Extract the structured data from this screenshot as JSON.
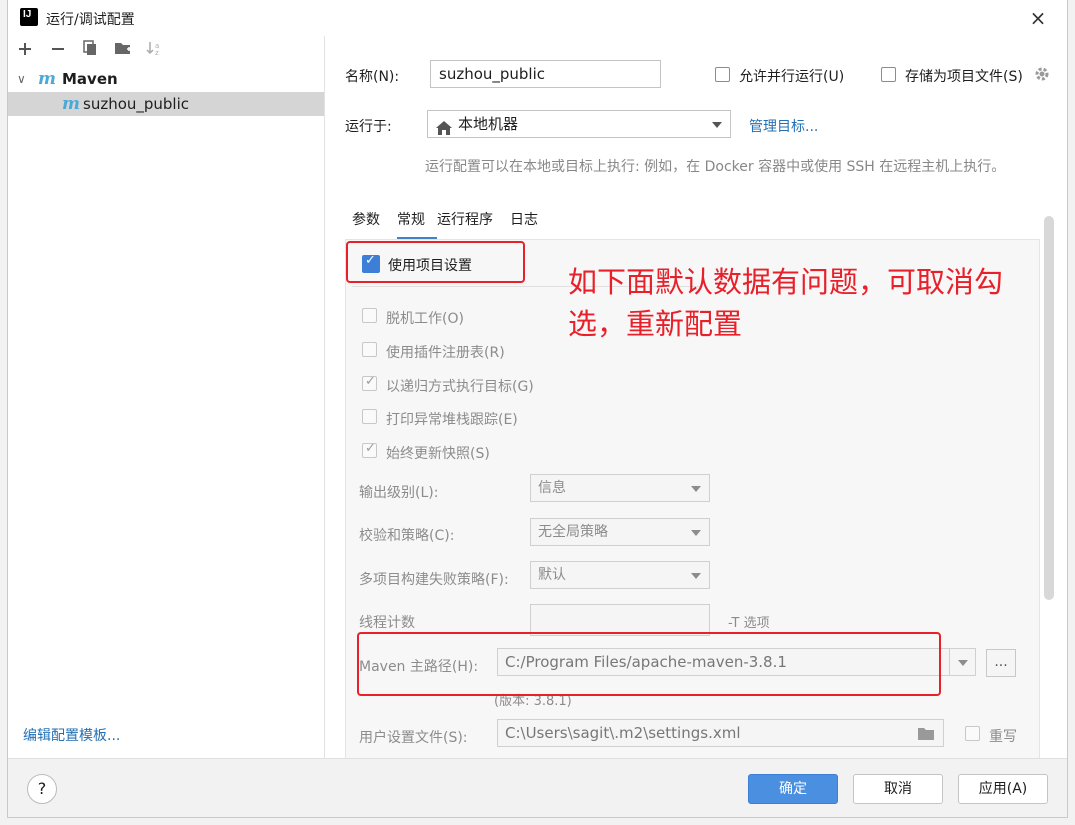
{
  "window": {
    "title": "运行/调试配置",
    "close_icon": "×"
  },
  "left_panel": {
    "toolbar_icons": [
      "plus-icon",
      "minus-icon",
      "copy-icon",
      "new-folder-icon",
      "sort-icon"
    ],
    "tree": {
      "group_label": "Maven",
      "item_label": "suzhou_public"
    },
    "edit_templates_link": "编辑配置模板..."
  },
  "form": {
    "name_label": "名称(N):",
    "name_value": "suzhou_public",
    "allow_parallel_label": "允许并行运行(U)",
    "store_as_file_label": "存储为项目文件(S)",
    "run_on_label": "运行于:",
    "run_on_value": "本地机器",
    "manage_targets_link": "管理目标...",
    "run_on_hint": "运行配置可以在本地或目标上执行: 例如，在 Docker 容器中或使用 SSH 在远程主机上执行。"
  },
  "tabs": [
    {
      "label": "参数"
    },
    {
      "label": "常规",
      "selected": true
    },
    {
      "label": "运行程序"
    },
    {
      "label": "日志"
    }
  ],
  "general": {
    "use_project_settings": {
      "label": "使用项目设置",
      "checked": true
    },
    "checkboxes": [
      {
        "label": "脱机工作(O)",
        "checked": false
      },
      {
        "label": "使用插件注册表(R)",
        "checked": false
      },
      {
        "label": "以递归方式执行目标(G)",
        "checked": true
      },
      {
        "label": "打印异常堆栈跟踪(E)",
        "checked": false
      },
      {
        "label": "始终更新快照(S)",
        "checked": true
      }
    ],
    "output_level": {
      "label": "输出级别(L):",
      "value": "信息"
    },
    "checksum_policy": {
      "label": "校验和策略(C):",
      "value": "无全局策略"
    },
    "multiproject_fail": {
      "label": "多项目构建失败策略(F):",
      "value": "默认"
    },
    "thread_count": {
      "label": "线程计数",
      "value": "",
      "suffix": "-T 选项"
    },
    "maven_home": {
      "label": "Maven 主路径(H):",
      "value": "C:/Program Files/apache-maven-3.8.1",
      "browse_label": "...",
      "version": "(版本: 3.8.1)"
    },
    "user_settings": {
      "label": "用户设置文件(S):",
      "value": "C:\\Users\\sagit\\.m2\\settings.xml",
      "override_label": "重写"
    }
  },
  "annotation": {
    "text_line1": "如下面默认数据有问题，可取消勾",
    "text_line2": "选，重新配置"
  },
  "buttons": {
    "ok": "确定",
    "cancel": "取消",
    "apply": "应用(A)",
    "help": "?"
  },
  "colors": {
    "accent": "#4a8fe0",
    "annotation": "#e8202a",
    "link": "#2470b3"
  }
}
